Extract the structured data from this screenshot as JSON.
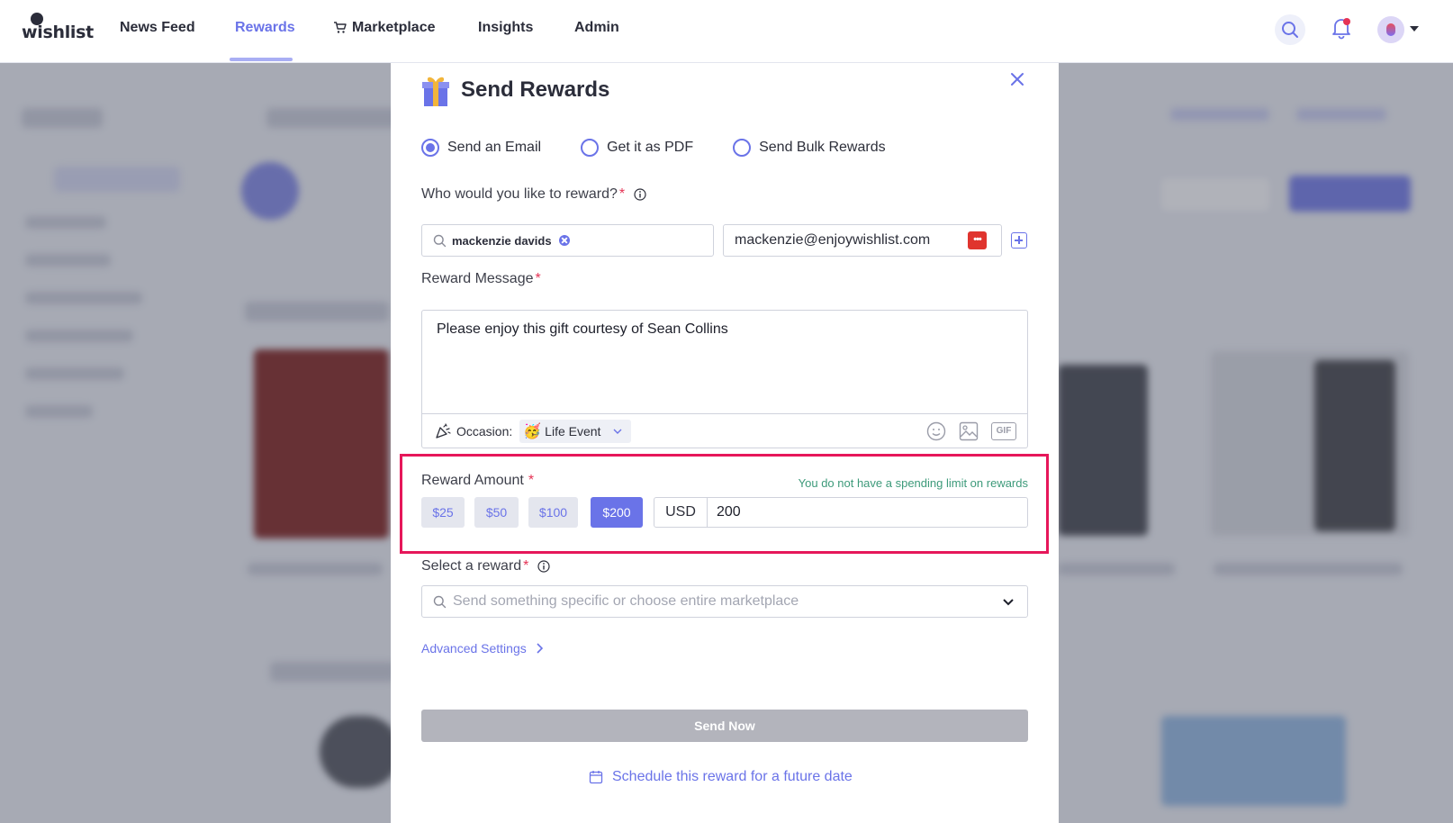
{
  "nav": {
    "logo": "wishlist",
    "items": [
      {
        "label": "News Feed"
      },
      {
        "label": "Rewards"
      },
      {
        "label": "Marketplace"
      },
      {
        "label": "Insights"
      },
      {
        "label": "Admin"
      }
    ],
    "active": "Rewards"
  },
  "modal": {
    "title": "Send Rewards",
    "send_options": [
      "Send an Email",
      "Get it as PDF",
      "Send Bulk Rewards"
    ],
    "selected_option": "Send an Email",
    "recipient_label": "Who would you like to reward?",
    "recipient_chip": "mackenzie davids",
    "recipient_email": "mackenzie@enjoywishlist.com",
    "message_label": "Reward Message",
    "message_text": "Please enjoy this gift courtesy of Sean Collins",
    "occasion_label": "Occasion:",
    "occasion_value": "Life Event",
    "occasion_emoji": "🥳",
    "gif_label": "GIF",
    "amount_label": "Reward Amount",
    "spending_note": "You do not have a spending limit on rewards",
    "amount_presets": [
      "$25",
      "$50",
      "$100",
      "$200"
    ],
    "selected_preset": "$200",
    "currency": "USD",
    "amount_value": "200",
    "select_reward_label": "Select a reward",
    "select_reward_placeholder": "Send something specific or choose entire marketplace",
    "advanced_settings": "Advanced Settings",
    "send_now": "Send Now",
    "schedule": "Schedule this reward for a future date"
  },
  "colors": {
    "accent": "#6a73e8",
    "highlight_border": "#e6175a",
    "required": "#e53355",
    "spending_note": "#3d9a7a",
    "disabled_button": "#b3b4bc"
  }
}
